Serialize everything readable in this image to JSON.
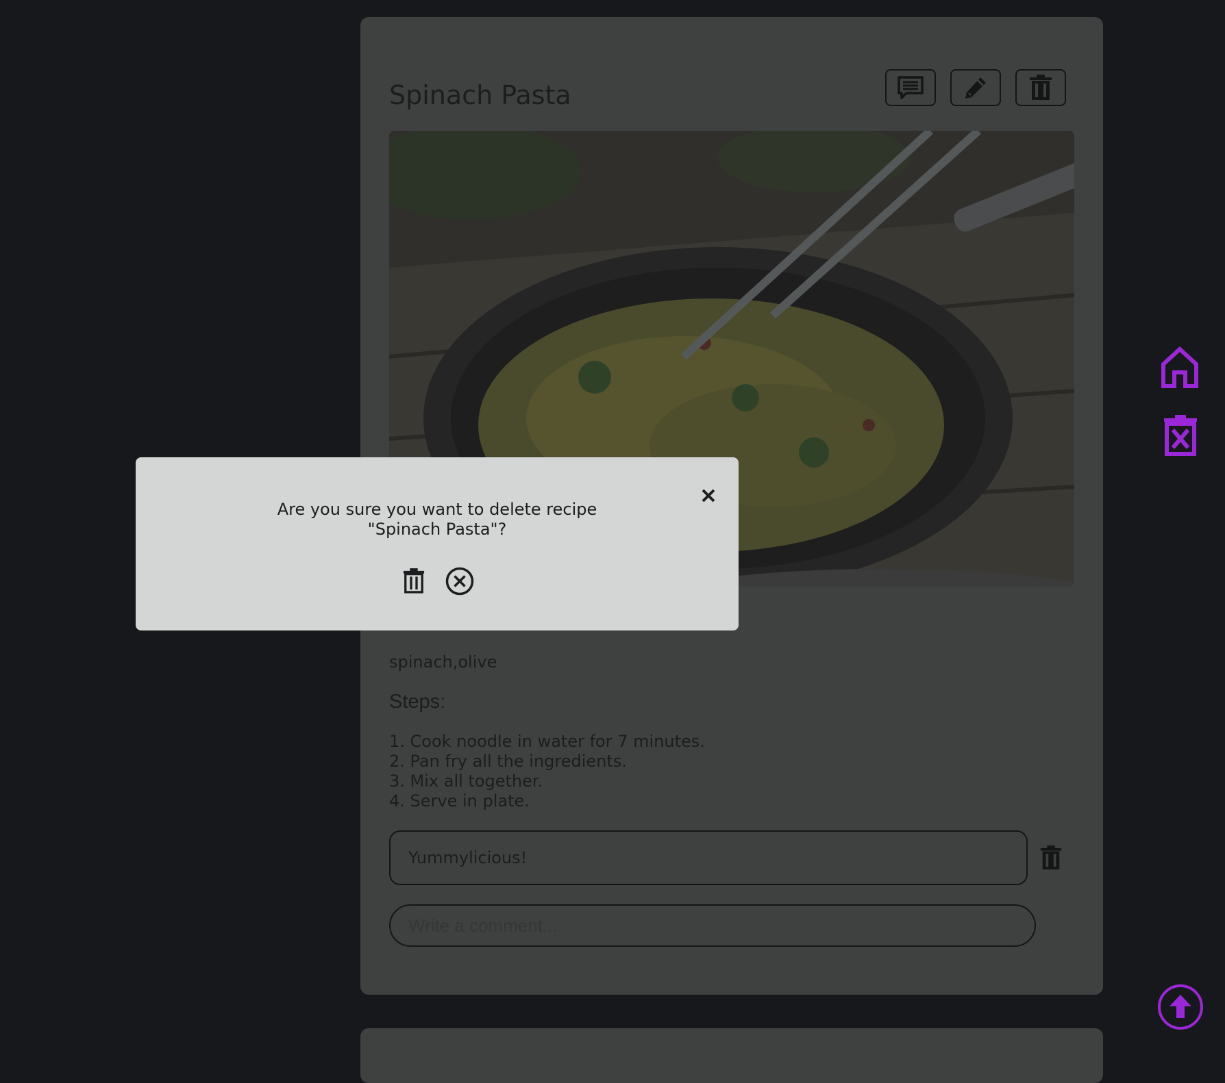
{
  "recipe": {
    "title": "Spinach Pasta",
    "ingredients": "spinach,olive",
    "steps_heading": "Steps:",
    "steps": [
      "1. Cook noodle in water for 7 minutes.",
      "2. Pan fry all the ingredients.",
      "3. Mix all together.",
      "4. Serve in plate."
    ],
    "image_alt": "spinach-pasta-photo"
  },
  "actions": {
    "comment_icon": "comment-icon",
    "edit_icon": "pencil-icon",
    "delete_icon": "trash-icon"
  },
  "comments": [
    {
      "text": "Yummylicious!"
    }
  ],
  "comment_input": {
    "placeholder": "Write a comment..."
  },
  "side_nav": {
    "home_icon": "home-icon",
    "clear_icon": "trash-x-icon",
    "scroll_top_icon": "arrow-up-circle-icon"
  },
  "dialog": {
    "message_line1": "Are you sure you want to delete recipe",
    "message_line2": "\"Spinach Pasta\"?",
    "confirm_icon": "trash-icon",
    "cancel_icon": "x-circle-icon",
    "close_icon": "close-icon"
  },
  "colors": {
    "page_background": "#17181b",
    "card_background": "#3f4141",
    "dialog_background": "#d4d6d6",
    "accent": "#9a27d8"
  }
}
